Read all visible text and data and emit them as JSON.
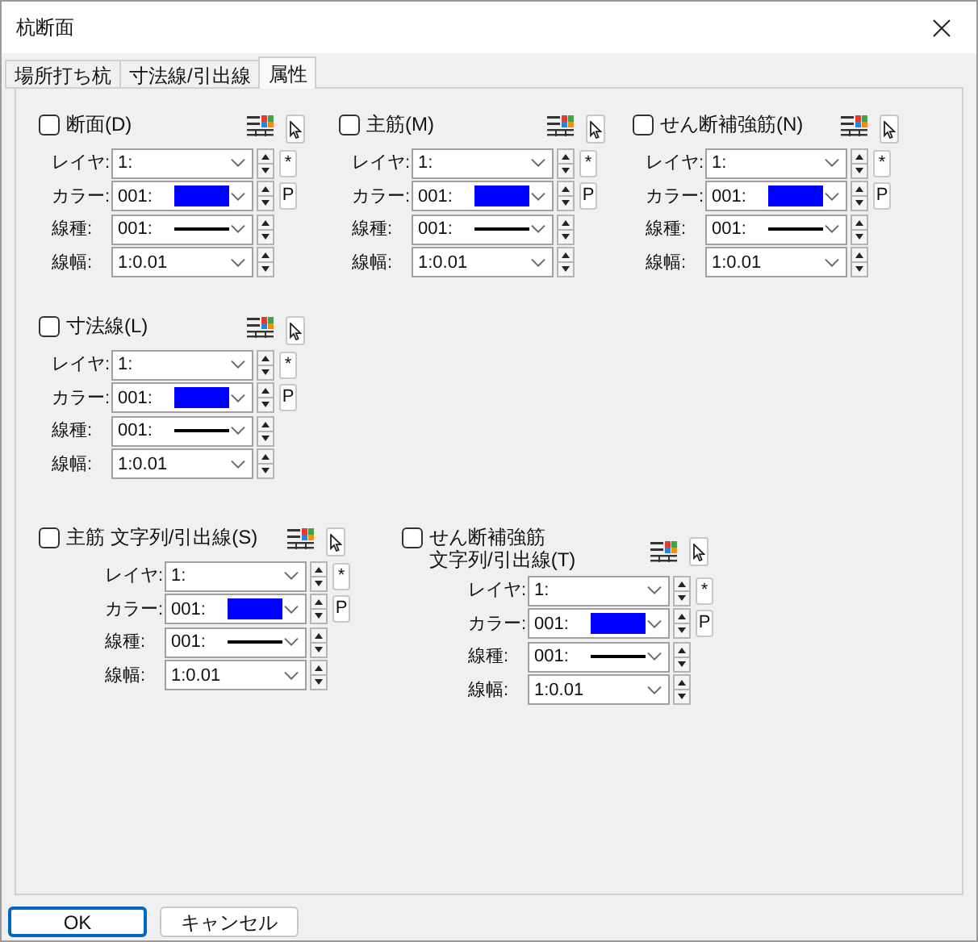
{
  "window": {
    "title": "杭断面"
  },
  "tabs": [
    {
      "label": "場所打ち杭",
      "selected": false
    },
    {
      "label": "寸法線/引出線",
      "selected": false
    },
    {
      "label": "属性",
      "selected": true
    }
  ],
  "rows": [
    [
      {
        "label": "断面(D)",
        "checked": false,
        "fields": [
          {
            "kind": "plain",
            "label": "レイヤ:",
            "value": "1:",
            "side": "*"
          },
          {
            "kind": "color",
            "label": "カラー:",
            "value": "001:",
            "color": "#0000ff",
            "side": "P"
          },
          {
            "kind": "line",
            "label": "線種:",
            "value": "001:"
          },
          {
            "kind": "plain",
            "label": "線幅:",
            "value": "1:0.01"
          }
        ]
      },
      {
        "label": "主筋(M)",
        "checked": false,
        "fields": [
          {
            "kind": "plain",
            "label": "レイヤ:",
            "value": "1:",
            "side": "*"
          },
          {
            "kind": "color",
            "label": "カラー:",
            "value": "001:",
            "color": "#0000ff",
            "side": "P"
          },
          {
            "kind": "line",
            "label": "線種:",
            "value": "001:"
          },
          {
            "kind": "plain",
            "label": "線幅:",
            "value": "1:0.01"
          }
        ]
      },
      {
        "label": "せん断補強筋(N)",
        "checked": false,
        "fields": [
          {
            "kind": "plain",
            "label": "レイヤ:",
            "value": "1:",
            "side": "*"
          },
          {
            "kind": "color",
            "label": "カラー:",
            "value": "001:",
            "color": "#0000ff",
            "side": "P"
          },
          {
            "kind": "line",
            "label": "線種:",
            "value": "001:"
          },
          {
            "kind": "plain",
            "label": "線幅:",
            "value": "1:0.01"
          }
        ]
      }
    ],
    [
      {
        "label": "寸法線(L)",
        "checked": false,
        "fields": [
          {
            "kind": "plain",
            "label": "レイヤ:",
            "value": "1:",
            "side": "*"
          },
          {
            "kind": "color",
            "label": "カラー:",
            "value": "001:",
            "color": "#0000ff",
            "side": "P"
          },
          {
            "kind": "line",
            "label": "線種:",
            "value": "001:"
          },
          {
            "kind": "plain",
            "label": "線幅:",
            "value": "1:0.01"
          }
        ]
      }
    ],
    [
      {
        "label": "主筋 文字列/引出線(S)",
        "checked": false,
        "fields": [
          {
            "kind": "plain",
            "label": "レイヤ:",
            "value": "1:",
            "side": "*"
          },
          {
            "kind": "color",
            "label": "カラー:",
            "value": "001:",
            "color": "#0000ff",
            "side": "P"
          },
          {
            "kind": "line",
            "label": "線種:",
            "value": "001:"
          },
          {
            "kind": "plain",
            "label": "線幅:",
            "value": "1:0.01"
          }
        ]
      },
      {
        "label": "せん断補強筋",
        "label_line_2": "文字列/引出線(T)",
        "checked": false,
        "fields": [
          {
            "kind": "plain",
            "label": "レイヤ:",
            "value": "1:",
            "side": "*"
          },
          {
            "kind": "color",
            "label": "カラー:",
            "value": "001:",
            "color": "#0000ff",
            "side": "P"
          },
          {
            "kind": "line",
            "label": "線種:",
            "value": "001:"
          },
          {
            "kind": "plain",
            "label": "線幅:",
            "value": "1:0.01"
          }
        ]
      }
    ]
  ],
  "buttons": [
    "OK",
    "キャンセル"
  ]
}
